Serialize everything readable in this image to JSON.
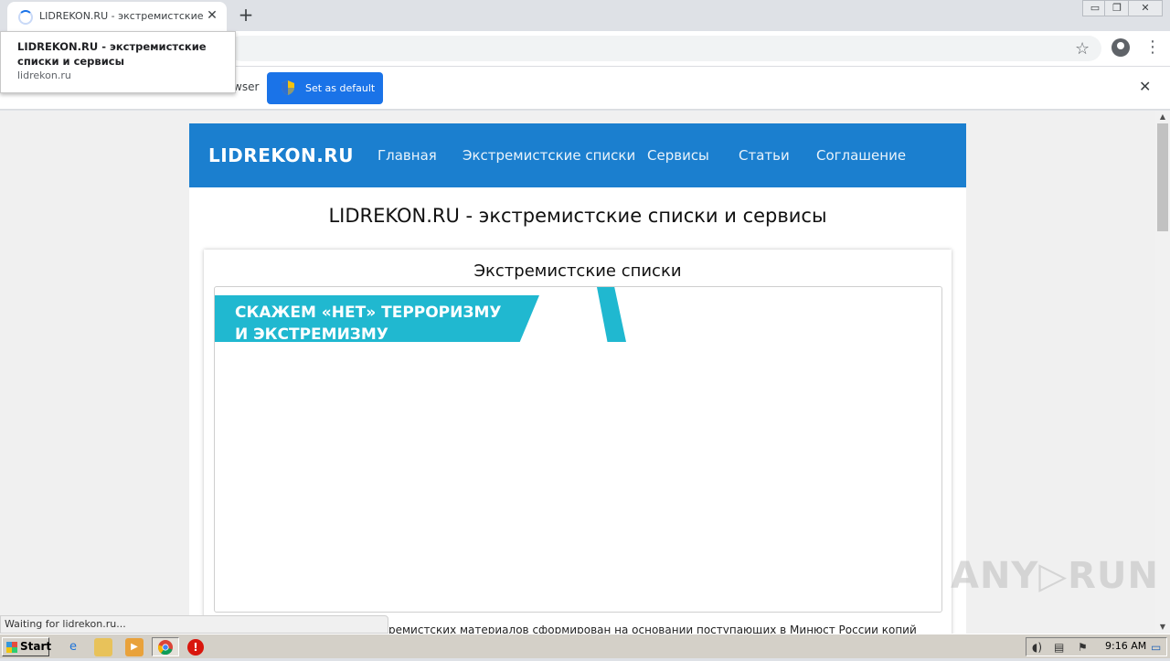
{
  "browser": {
    "tab_title": "LIDREKON.RU - экстремистские спи",
    "tab_close": "✕",
    "new_tab": "+",
    "window_controls": {
      "minimize": "▭",
      "restore": "❐",
      "close": "✕"
    },
    "tooltip": {
      "title": "LIDREKON.RU - экстремистские списки и сервисы",
      "url": "lidrekon.ru"
    },
    "infobar": {
      "text": "wser",
      "button": "Set as default",
      "close": "✕"
    },
    "toolbar_icons": {
      "star": "☆",
      "menu": "⋮"
    },
    "status": "Waiting for lidrekon.ru..."
  },
  "site": {
    "brand": "LIDREKON.RU",
    "nav": [
      "Главная",
      "Экстремистские списки",
      "Сервисы",
      "Статьи",
      "Соглашение"
    ],
    "heading": "LIDREKON.RU - экстремистские списки и сервисы",
    "card": {
      "title": "Экстремистские списки",
      "banner_line1": "СКАЖЕМ «НЕТ» ТЕРРОРИЗМУ",
      "banner_line2": "И ЭКСТРЕМИЗМУ"
    },
    "body_text": "тремистских материалов сформирован на основании поступающих в Минюст России копий"
  },
  "watermark": "ANY▷RUN",
  "taskbar": {
    "start": "Start",
    "time": "9:16 AM"
  },
  "colors": {
    "nav_bg": "#1b7fcf",
    "banner": "#20b8d0",
    "primary_button": "#1a73e8"
  }
}
